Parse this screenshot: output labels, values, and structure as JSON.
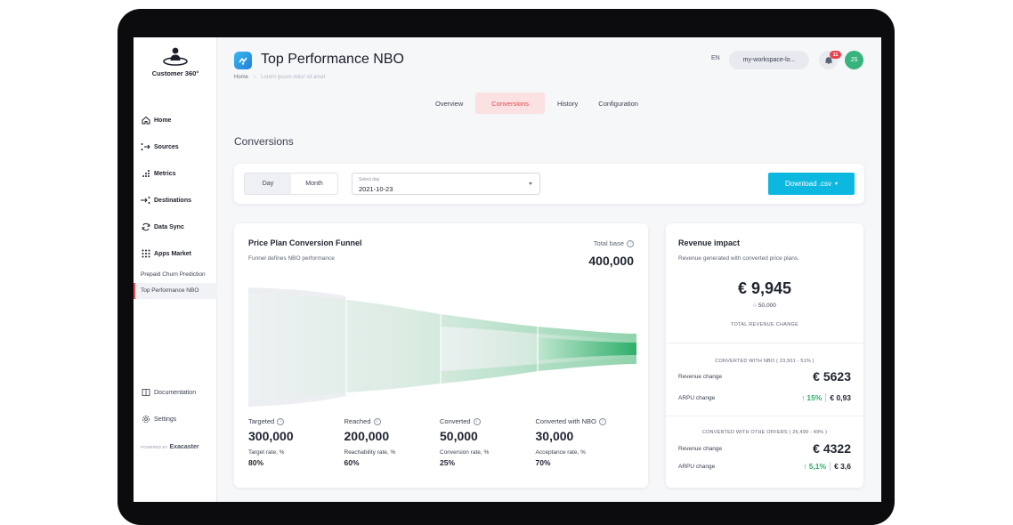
{
  "app": {
    "brand_name": "Customer 360°",
    "page_title": "Top Performance NBO"
  },
  "breadcrumb": {
    "home": "Home",
    "current": "Lorem ipsum dolor sit amet"
  },
  "header": {
    "language": "EN",
    "workspace": "my-workspace-lo...",
    "notifications": "11",
    "avatar_initials": "JS"
  },
  "sidebar": {
    "items": [
      {
        "label": "Home",
        "icon": "home-icon"
      },
      {
        "label": "Sources",
        "icon": "sources-icon"
      },
      {
        "label": "Metrics",
        "icon": "metrics-icon"
      },
      {
        "label": "Destinations",
        "icon": "destinations-icon"
      },
      {
        "label": "Data Sync",
        "icon": "sync-icon"
      },
      {
        "label": "Apps Market",
        "icon": "grid-icon"
      }
    ],
    "sub_items": [
      "Prepaid Churn Prediction",
      "Top Performance NBO"
    ],
    "bottom": [
      {
        "label": "Documentation",
        "icon": "book-icon"
      },
      {
        "label": "Settings",
        "icon": "gear-icon"
      }
    ],
    "powered_by": "POWERED BY",
    "powered_brand": "Exacaster"
  },
  "tabs": [
    "Overview",
    "Conversions",
    "History",
    "Configuration"
  ],
  "active_tab": "Conversions",
  "section_title": "Conversions",
  "filters": {
    "day_label": "Day",
    "month_label": "Month",
    "date_label": "Select day",
    "date_value": "2021-10-23",
    "download_label": "Download .csv"
  },
  "funnel": {
    "title": "Price Plan Conversion Funnel",
    "subtitle": "Funnel defines NBO performance",
    "total_base_label": "Total base",
    "total_base_value": "400,000",
    "stages": [
      {
        "name": "Targeted",
        "value": "300,000",
        "rate_label": "Target rate, %",
        "rate": "80%"
      },
      {
        "name": "Reached",
        "value": "200,000",
        "rate_label": "Reachability rate, %",
        "rate": "60%"
      },
      {
        "name": "Converted",
        "value": "50,000",
        "rate_label": "Conversion rate, %",
        "rate": "25%"
      },
      {
        "name": "Converted with NBO",
        "value": "30,000",
        "rate_label": "Acceptance rate, %",
        "rate": "70%"
      }
    ],
    "colors": {
      "light": "#e8ebee",
      "mid": "#9ed9b8",
      "strong": "#2fae6a"
    }
  },
  "revenue": {
    "title": "Revenue impact",
    "subtitle": "Revenue generated with converted price plans.",
    "total": "€ 9,945",
    "users": "50,000",
    "total_label": "TOTAL REVENUE CHANGE",
    "nbo": {
      "title": "CONVERTED WITH NBO ( 23,501 - 51% )",
      "revenue_label": "Revenue change",
      "revenue_value": "€ 5623",
      "arpu_label": "ARPU change",
      "arpu_pct": "15%",
      "arpu_value": "€ 0,93"
    },
    "other": {
      "title": "CONVERTED WITH OTHE OFFERS ( 26,499 - 49% )",
      "revenue_label": "Revenue change",
      "revenue_value": "€ 4322",
      "arpu_label": "ARPU change",
      "arpu_pct": "5,1%",
      "arpu_value": "€ 3,6"
    }
  }
}
